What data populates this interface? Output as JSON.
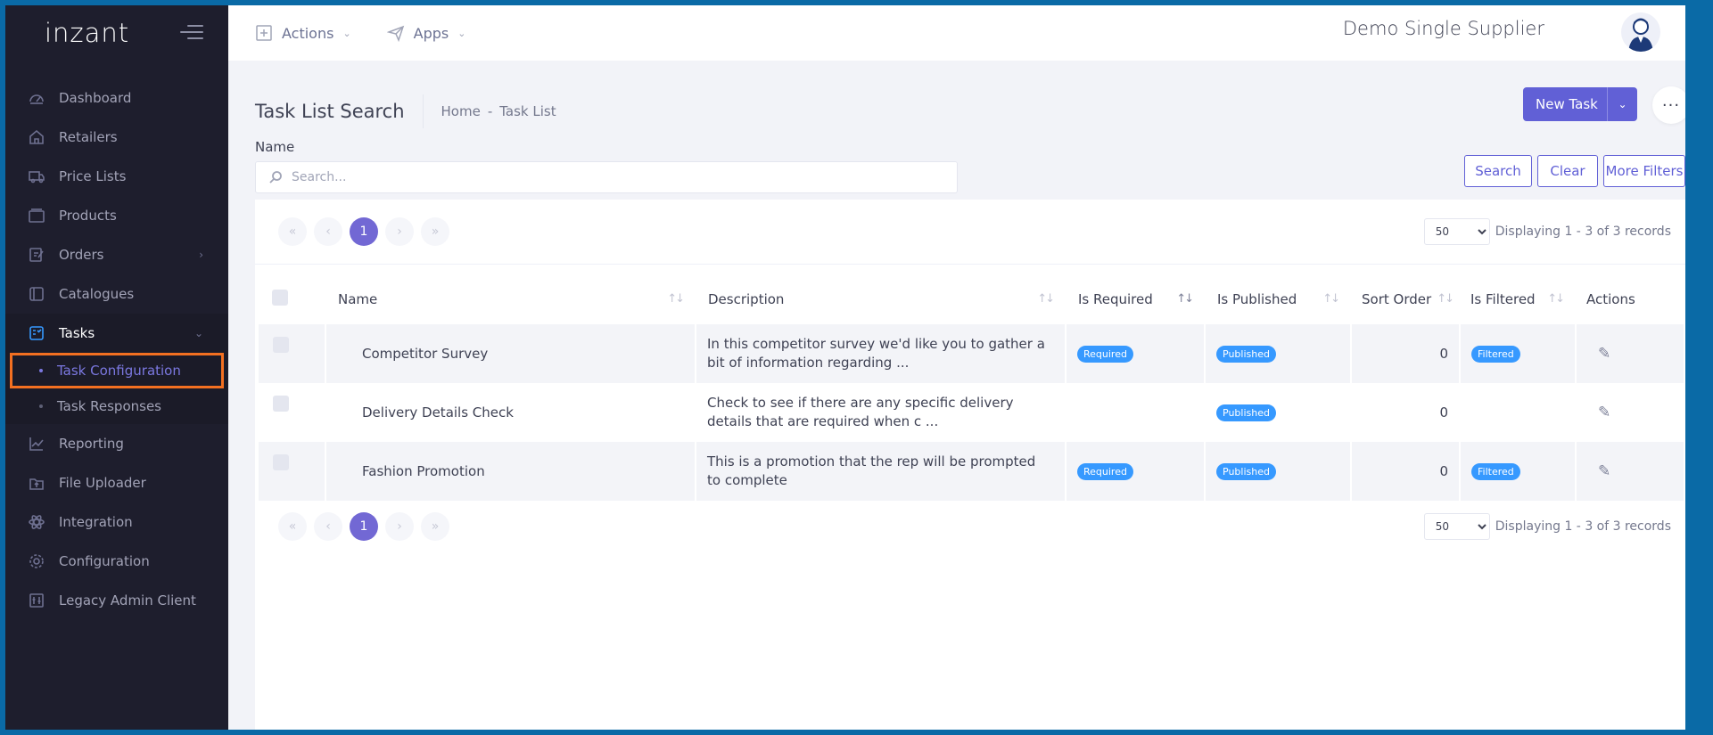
{
  "brand": "inzant",
  "topbar": {
    "actions_label": "Actions",
    "apps_label": "Apps",
    "company": "Demo Single Supplier"
  },
  "sidebar": {
    "items": [
      {
        "label": "Dashboard",
        "icon": "dashboard-icon"
      },
      {
        "label": "Retailers",
        "icon": "home-icon"
      },
      {
        "label": "Price Lists",
        "icon": "truck-icon"
      },
      {
        "label": "Products",
        "icon": "box-icon"
      },
      {
        "label": "Orders",
        "icon": "edit-icon"
      },
      {
        "label": "Catalogues",
        "icon": "book-icon"
      },
      {
        "label": "Tasks",
        "icon": "tasks-icon"
      },
      {
        "label": "Reporting",
        "icon": "chart-icon"
      },
      {
        "label": "File Uploader",
        "icon": "upload-icon"
      },
      {
        "label": "Integration",
        "icon": "atom-icon"
      },
      {
        "label": "Configuration",
        "icon": "gear-icon"
      },
      {
        "label": "Legacy Admin Client",
        "icon": "sliders-icon"
      }
    ],
    "task_sub": [
      "Task Configuration",
      "Task Responses"
    ]
  },
  "page": {
    "title": "Task List Search",
    "breadcrumb_home": "Home",
    "breadcrumb_sep": "-",
    "breadcrumb_current": "Task List",
    "new_task_label": "New Task",
    "more_label": "···",
    "name_label": "Name"
  },
  "search": {
    "placeholder": "Search..."
  },
  "filters": {
    "search": "Search",
    "clear": "Clear",
    "more": "More Filters"
  },
  "pager": {
    "current": "1",
    "per_page": "50",
    "records": "Displaying 1 - 3 of 3 records"
  },
  "table": {
    "headers": [
      "Name",
      "Description",
      "Is Required",
      "Is Published",
      "Sort Order",
      "Is Filtered",
      "Actions"
    ],
    "rows": [
      {
        "name": "Competitor Survey",
        "description": "In this competitor survey we'd like you to gather a bit of information regarding ...",
        "required": "Required",
        "published": "Published",
        "sort": "0",
        "filtered": "Filtered"
      },
      {
        "name": "Delivery Details Check",
        "description": "Check to see if there are any specific delivery details that are required when c ...",
        "required": "",
        "published": "Published",
        "sort": "0",
        "filtered": ""
      },
      {
        "name": "Fashion Promotion",
        "description": "This is a promotion that the rep will be prompted to complete",
        "required": "Required",
        "published": "Published",
        "sort": "0",
        "filtered": "Filtered"
      }
    ]
  },
  "colors": {
    "accent": "#6160d6",
    "badge": "#3699ff",
    "sidebar": "#1e1e2d",
    "highlight": "#f37021"
  }
}
